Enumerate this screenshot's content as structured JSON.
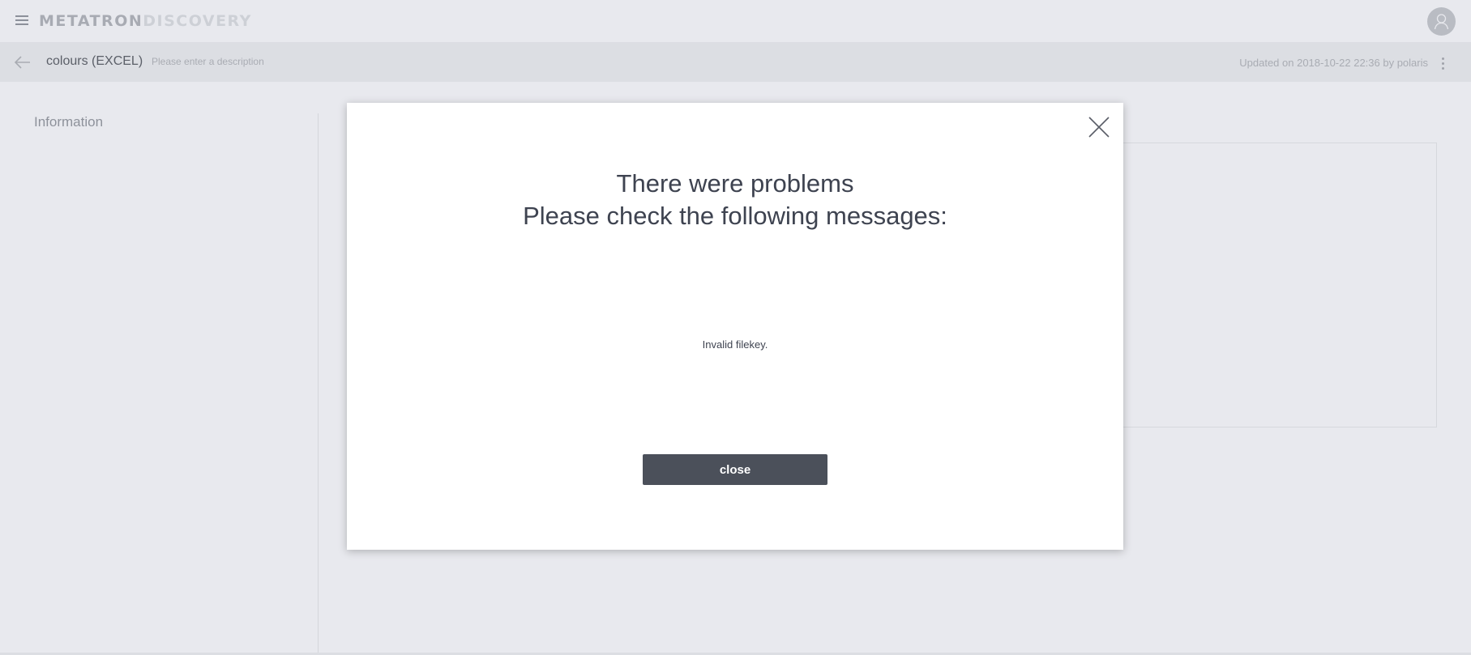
{
  "app": {
    "logo_primary": "METATRON",
    "logo_secondary": "DISCOVERY",
    "menu_icon": "hamburger-menu-icon",
    "avatar_icon": "user-avatar-icon"
  },
  "subheader": {
    "title": "colours (EXCEL)",
    "description_placeholder": "Please enter a description",
    "updated_text": "Updated on 2018-10-22 22:36 by polaris",
    "back_icon": "arrow-left-icon",
    "more_icon": "vertical-dots-icon"
  },
  "sidebar": {
    "section_label": "Information"
  },
  "modal": {
    "title_line1": "There were problems",
    "title_line2": "Please check the following messages:",
    "message": "Invalid filekey.",
    "close_button_label": "close",
    "close_icon": "close-x-icon"
  },
  "colors": {
    "background": "#e8e9ee",
    "subheader": "#dcdee3",
    "button": "#4b505a",
    "text_dark": "#3e4350"
  }
}
